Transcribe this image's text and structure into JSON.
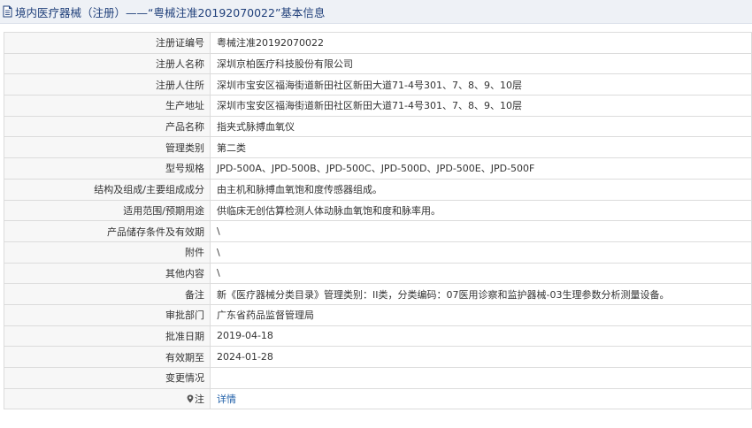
{
  "header": {
    "title": "境内医疗器械（注册）——“粤械注准20192070022”基本信息"
  },
  "rows": [
    {
      "label": "注册证编号",
      "value": "粤械注准20192070022"
    },
    {
      "label": "注册人名称",
      "value": "深圳京柏医疗科技股份有限公司"
    },
    {
      "label": "注册人住所",
      "value": "深圳市宝安区福海街道新田社区新田大道71-4号301、7、8、9、10层"
    },
    {
      "label": "生产地址",
      "value": "深圳市宝安区福海街道新田社区新田大道71-4号301、7、8、9、10层"
    },
    {
      "label": "产品名称",
      "value": "指夹式脉搏血氧仪"
    },
    {
      "label": "管理类别",
      "value": "第二类"
    },
    {
      "label": "型号规格",
      "value": "JPD-500A、JPD-500B、JPD-500C、JPD-500D、JPD-500E、JPD-500F"
    },
    {
      "label": "结构及组成/主要组成成分",
      "value": "由主机和脉搏血氧饱和度传感器组成。"
    },
    {
      "label": "适用范围/预期用途",
      "value": "供临床无创估算检测人体动脉血氧饱和度和脉率用。"
    },
    {
      "label": "产品储存条件及有效期",
      "value": "\\"
    },
    {
      "label": "附件",
      "value": "\\"
    },
    {
      "label": "其他内容",
      "value": "\\"
    },
    {
      "label": "备注",
      "value": "新《医疗器械分类目录》管理类别：II类，分类编码：07医用诊察和监护器械-03生理参数分析测量设备。"
    },
    {
      "label": "审批部门",
      "value": "广东省药品监督管理局"
    },
    {
      "label": "批准日期",
      "value": "2019-04-18"
    },
    {
      "label": "有效期至",
      "value": "2024-01-28"
    },
    {
      "label": "变更情况",
      "value": ""
    }
  ],
  "note_row": {
    "label": "注",
    "link_text": "详情"
  },
  "colors": {
    "title_text": "#1f3f7a",
    "title_bg": "#eef1f6",
    "label_bg": "#f7f7f7",
    "border": "#dcdcdc",
    "link": "#1f5fa8"
  },
  "icons": {
    "title_icon": "document-icon",
    "note_icon": "map-pin-icon"
  }
}
